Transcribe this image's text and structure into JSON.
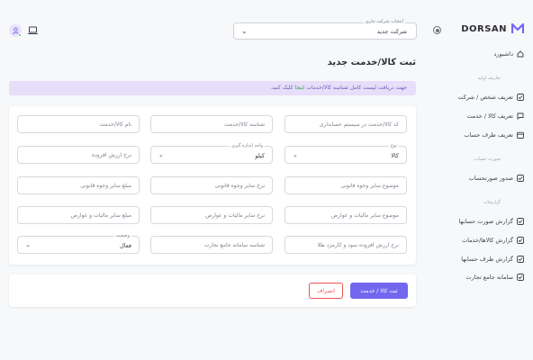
{
  "brand": {
    "name": "DORSAN"
  },
  "company": {
    "legend": "انتخاب شرکت جاری",
    "value": "شرکت جدید"
  },
  "sidebar": {
    "dashboard": "داشبورد",
    "sections": [
      {
        "header": "تعاریف اولیه",
        "items": [
          "تعریف شخص / شرکت",
          "تعریف کالا / خدمت",
          "تعریف طرف حساب"
        ]
      },
      {
        "header": "صورت حساب",
        "items": [
          "صدور صورتحساب"
        ]
      },
      {
        "header": "گزارشات",
        "items": [
          "گزارش صورت حسابها",
          "گزارش کالاها/خدمات",
          "گزارش طرف حسابها",
          "سامانه جامع تجارت"
        ]
      }
    ]
  },
  "page": {
    "title": "ثبت کالا/خدمت جدید",
    "info_text": "جهت دریافت لیست کامل شناسه کالا/خدمات",
    "info_link": "اینجا",
    "info_suffix": "کلیک کنید."
  },
  "form": {
    "row1": [
      "کد کالا/خدمت در سیستم حسابداری",
      "شناسه کالا/خدمت",
      "نام کالا/خدمت"
    ],
    "type": {
      "legend": "نوع",
      "value": "کالا"
    },
    "unit": {
      "legend": "واحد اندازه گیری",
      "value": "کیلو"
    },
    "vat_rate": "نرخ ارزش افزوده",
    "row3": [
      "موضوع سایر وجوه قانونی",
      "نرخ سایر وجوه قانونی",
      "مبلغ سایر وجوه قانونی"
    ],
    "row4": [
      "موضوع سایر مالیات و عوارض",
      "نرخ سایر مالیات و عوارض",
      "مبلغ سایر مالیات و عوارض"
    ],
    "row5": [
      "نرخ ارزش افزوده سود و کارمزد طلا",
      "شناسه سامانه جامع تجارت"
    ],
    "status": {
      "legend": "وضعیت",
      "value": "فعال"
    }
  },
  "actions": {
    "submit": "ثبت کالا / خدمت",
    "cancel": "انصراف"
  },
  "colors": {
    "primary": "#7367f0",
    "danger": "#ea5455",
    "info_bg": "#e7defa"
  }
}
